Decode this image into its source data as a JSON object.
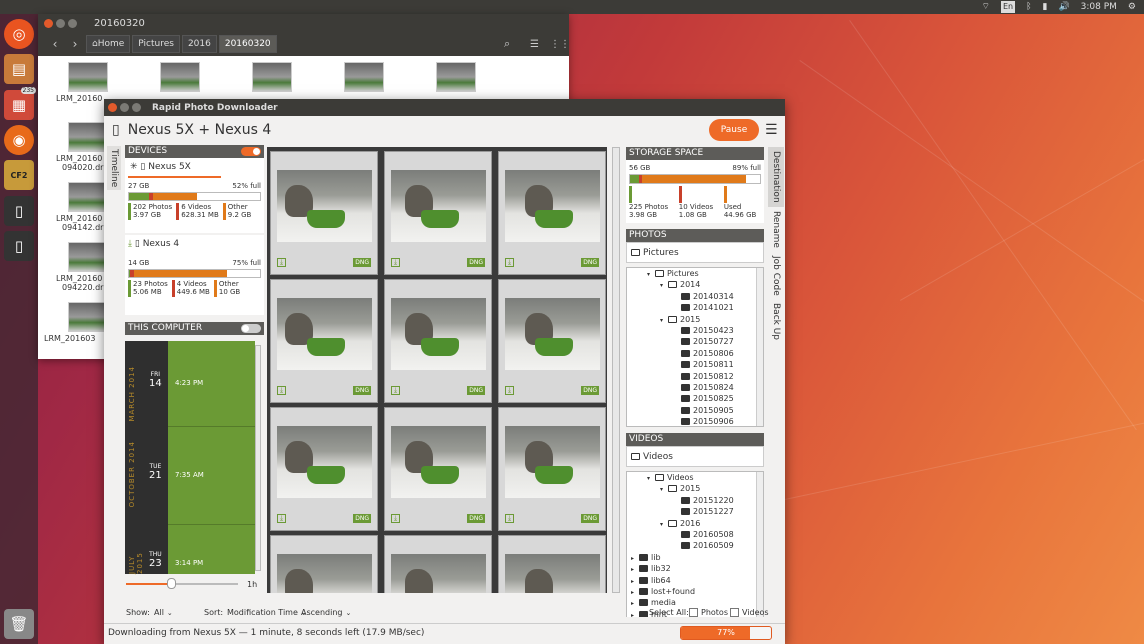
{
  "topbar": {
    "kbd_layout": "En",
    "clock": "3:08 PM"
  },
  "launcher": {
    "badge_count": "235",
    "cf_label": "CF2"
  },
  "file_manager": {
    "title": "20160320",
    "breadcrumbs": [
      "Home",
      "Pictures",
      "2016",
      "20160320"
    ],
    "files": [
      {
        "name": "LRM_20160320_093940.dng"
      },
      {
        "name": "LRM_20160320_094020.dng"
      },
      {
        "name": "LRM_20160320_094142.dng"
      },
      {
        "name": "LRM_20160320_094220.dng"
      },
      {
        "name": "LRM_20160320_..."
      }
    ],
    "file_label_lines": [
      "LRM_20160",
      "093940.dn",
      "LRM_20160",
      "094020.dr",
      "LRM_20160",
      "094142.dr",
      "LRM_20160",
      "094220.dr",
      "LRM_201603"
    ]
  },
  "rpd": {
    "window_title": "Rapid Photo Downloader",
    "device_header": "Nexus 5X + Nexus 4",
    "pause_label": "Pause",
    "timeline_tab": "Timeline",
    "devices": {
      "section_title": "DEVICES",
      "items": [
        {
          "name": "Nexus 5X",
          "capacity": "27 GB",
          "full": "52% full",
          "photos": "202 Photos",
          "photos_size": "3.97 GB",
          "videos": "6 Videos",
          "videos_size": "628.31 MB",
          "other": "Other",
          "other_size": "9.2 GB",
          "bar": {
            "photos": 0.15,
            "videos": 0.03,
            "other": 0.34
          }
        },
        {
          "name": "Nexus 4",
          "capacity": "14 GB",
          "full": "75% full",
          "photos": "23 Photos",
          "photos_size": "5.06 MB",
          "videos": "4 Videos",
          "videos_size": "449.6 MB",
          "other": "Other",
          "other_size": "10 GB",
          "bar": {
            "photos": 0.01,
            "videos": 0.03,
            "other": 0.71
          }
        }
      ]
    },
    "this_computer": {
      "section_title": "THIS COMPUTER"
    },
    "timeline": {
      "months": [
        "MARCH 2014",
        "OCTOBER 2014",
        "JULY 2015"
      ],
      "days": [
        {
          "dow": "FRI",
          "day": "14",
          "time": "4:23 PM"
        },
        {
          "dow": "TUE",
          "day": "21",
          "time": "7:35 AM"
        },
        {
          "dow": "THU",
          "day": "23",
          "time": "3:14 PM"
        }
      ],
      "slider_label": "1h",
      "slider_value": 0.4
    },
    "thumbnails": {
      "badge": "DNG",
      "count_visible": 12
    },
    "storage": {
      "section_title": "STORAGE SPACE",
      "capacity": "56 GB",
      "full": "89% full",
      "photos": "225 Photos",
      "photos_size": "3.98 GB",
      "videos": "10 Videos",
      "videos_size": "1.08 GB",
      "used": "Used",
      "used_size": "44.96 GB",
      "bar": {
        "photos": 0.07,
        "videos": 0.02,
        "used": 0.8
      }
    },
    "photos_dest": {
      "section_title": "PHOTOS",
      "folder": "Pictures",
      "tree": [
        {
          "label": "Pictures",
          "level": 1,
          "open": true
        },
        {
          "label": "2014",
          "level": 2,
          "open": true
        },
        {
          "label": "20140314",
          "level": 3
        },
        {
          "label": "20141021",
          "level": 3
        },
        {
          "label": "2015",
          "level": 2,
          "open": true
        },
        {
          "label": "20150423",
          "level": 3
        },
        {
          "label": "20150727",
          "level": 3
        },
        {
          "label": "20150806",
          "level": 3
        },
        {
          "label": "20150811",
          "level": 3
        },
        {
          "label": "20150812",
          "level": 3
        },
        {
          "label": "20150824",
          "level": 3
        },
        {
          "label": "20150825",
          "level": 3
        },
        {
          "label": "20150905",
          "level": 3
        },
        {
          "label": "20150906",
          "level": 3
        }
      ]
    },
    "videos_dest": {
      "section_title": "VIDEOS",
      "folder": "Videos",
      "tree": [
        {
          "label": "Videos",
          "level": 1,
          "open": true
        },
        {
          "label": "2015",
          "level": 2,
          "open": true
        },
        {
          "label": "20151220",
          "level": 3
        },
        {
          "label": "20151227",
          "level": 3
        },
        {
          "label": "2016",
          "level": 2,
          "open": true
        },
        {
          "label": "20160508",
          "level": 3
        },
        {
          "label": "20160509",
          "level": 3
        },
        {
          "label": "lib",
          "level": 0
        },
        {
          "label": "lib32",
          "level": 0
        },
        {
          "label": "lib64",
          "level": 0
        },
        {
          "label": "lost+found",
          "level": 0
        },
        {
          "label": "media",
          "level": 0
        },
        {
          "label": "mnt",
          "level": 0
        }
      ]
    },
    "right_tabs": [
      "Destination",
      "Rename",
      "Job Code",
      "Back Up"
    ],
    "bottom": {
      "show_label": "Show:",
      "show_value": "All",
      "sort_label": "Sort:",
      "sort_value": "Modification Time",
      "order_value": "Ascending",
      "select_all_label": "Select All:",
      "photos_label": "Photos",
      "videos_label": "Videos"
    },
    "status": "Downloading from Nexus 5X — 1 minute, 8 seconds left (17.9 MB/sec)",
    "progress": {
      "value": 0.77,
      "label": "77%"
    }
  }
}
